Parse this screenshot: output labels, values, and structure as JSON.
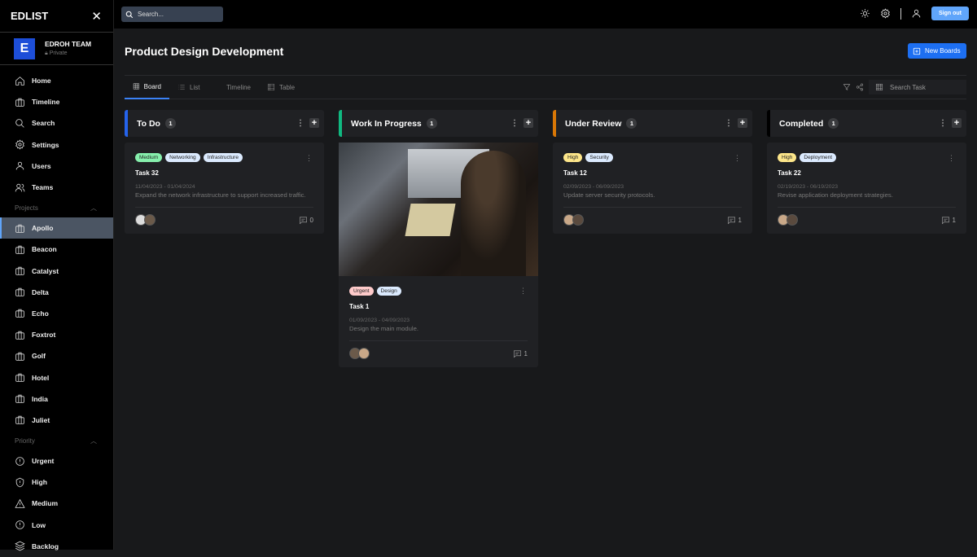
{
  "app": {
    "name": "EDLIST"
  },
  "team": {
    "logo": "E",
    "name": "EDROH TEAM",
    "visibility": "Private"
  },
  "nav": [
    {
      "label": "Home",
      "icon": "home-icon"
    },
    {
      "label": "Timeline",
      "icon": "briefcase-icon"
    },
    {
      "label": "Search",
      "icon": "search-icon"
    },
    {
      "label": "Settings",
      "icon": "gear-icon"
    },
    {
      "label": "Users",
      "icon": "user-icon"
    },
    {
      "label": "Teams",
      "icon": "users-icon"
    }
  ],
  "projects": {
    "label": "Projects",
    "items": [
      "Apollo",
      "Beacon",
      "Catalyst",
      "Delta",
      "Echo",
      "Foxtrot",
      "Golf",
      "Hotel",
      "India",
      "Juliet"
    ],
    "active": "Apollo"
  },
  "priority": {
    "label": "Priority",
    "items": [
      {
        "label": "Urgent",
        "icon": "alert-circle-icon"
      },
      {
        "label": "High",
        "icon": "shield-alert-icon"
      },
      {
        "label": "Medium",
        "icon": "alert-triangle-icon"
      },
      {
        "label": "Low",
        "icon": "alert-circle-icon"
      },
      {
        "label": "Backlog",
        "icon": "layers-icon"
      }
    ]
  },
  "topbar": {
    "search_placeholder": "Search...",
    "signout": "Sign out"
  },
  "page": {
    "title": "Product Design Development",
    "new_boards": "New Boards"
  },
  "tabs": [
    {
      "label": "Board",
      "active": true
    },
    {
      "label": "List"
    },
    {
      "label": "Timeline"
    },
    {
      "label": "Table"
    }
  ],
  "search_task": "Search Task",
  "colors": {
    "todo": "#2563eb",
    "progress": "#10b981",
    "review": "#d97706",
    "completed": "#000000",
    "accent": "#1d6ff2"
  },
  "columns": [
    {
      "name": "To Do",
      "count": "1",
      "cards": [
        {
          "tags": [
            {
              "label": "Medium",
              "color": "#86efac"
            },
            {
              "label": "Networking",
              "color": "#dbeafe"
            },
            {
              "label": "Infrastructure",
              "color": "#dbeafe"
            }
          ],
          "title": "Task 32",
          "dates": "11/04/2023 - 01/04/2024",
          "desc": "Expand the network infrastructure to support increased traffic.",
          "comments": "0"
        }
      ]
    },
    {
      "name": "Work In Progress",
      "count": "1",
      "cards": [
        {
          "image": true,
          "tags": [
            {
              "label": "Urgent",
              "color": "#fecaca"
            },
            {
              "label": "Design",
              "color": "#dbeafe"
            }
          ],
          "title": "Task 1",
          "dates": "01/09/2023 - 04/09/2023",
          "desc": "Design the main module.",
          "comments": "1"
        }
      ]
    },
    {
      "name": "Under Review",
      "count": "1",
      "cards": [
        {
          "tags": [
            {
              "label": "High",
              "color": "#fde68a"
            },
            {
              "label": "Security",
              "color": "#dbeafe"
            }
          ],
          "title": "Task 12",
          "dates": "02/09/2023 - 06/09/2023",
          "desc": "Update server security protocols.",
          "comments": "1"
        }
      ]
    },
    {
      "name": "Completed",
      "count": "1",
      "cards": [
        {
          "tags": [
            {
              "label": "High",
              "color": "#fde68a"
            },
            {
              "label": "Deployment",
              "color": "#dbeafe"
            }
          ],
          "title": "Task 22",
          "dates": "02/19/2023 - 06/19/2023",
          "desc": "Revise application deployment strategies.",
          "comments": "1"
        }
      ]
    }
  ]
}
